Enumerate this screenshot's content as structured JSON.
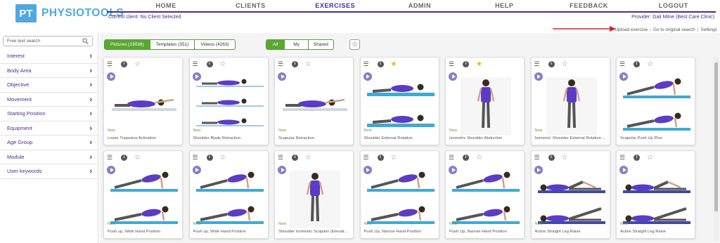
{
  "logo": {
    "mark": "PT",
    "name": "PHYSIOTOOLS"
  },
  "nav": [
    "HOME",
    "CLIENTS",
    "EXERCISES",
    "ADMIN",
    "HELP",
    "FEEDBACK",
    "LOGOUT"
  ],
  "nav_active": "EXERCISES",
  "client_status": "Current client: No Client Selected",
  "provider": "Provider: Gail Milne (Best Care Clinic)",
  "top_links": [
    "+ Upload exercise",
    "Go to original search",
    "Settings"
  ],
  "sidebar": {
    "search_placeholder": "Free text search",
    "filters": [
      "Interest",
      "Body Area",
      "Objective",
      "Movement",
      "Starting Position",
      "Equipment",
      "Age Group",
      "Module",
      "User keywords"
    ]
  },
  "media_tabs": [
    "Pictures (19038)",
    "Templates (351)",
    "Videos (4263)"
  ],
  "scope_tabs": [
    "All",
    "My",
    "Shared"
  ],
  "colors": {
    "brand_purple": "#4a2e8a",
    "logo_blue": "#4fa8e0",
    "green": "#59a832",
    "favorite": "#f5b400"
  },
  "cards": [
    {
      "caption": "Lower Trapezius Activation",
      "new": "New",
      "favorite": false,
      "pose": "prone"
    },
    {
      "caption": "Shoulder Blade Retraction",
      "new": "New",
      "favorite": false,
      "pose": "prone3"
    },
    {
      "caption": "Scapular Retraction",
      "new": "New",
      "favorite": false,
      "pose": "prone"
    },
    {
      "caption": "Shoulder External Rotation",
      "new": "New",
      "favorite": true,
      "pose": "side"
    },
    {
      "caption": "Isometric Shoulder Abduction",
      "new": "New",
      "favorite": true,
      "pose": "stand"
    },
    {
      "caption": "Isometric Shoulder External Rotation ...",
      "new": "New",
      "favorite": false,
      "pose": "stand"
    },
    {
      "caption": "Scapular Push Up Plus",
      "new": "",
      "favorite": false,
      "pose": "plank"
    },
    {
      "caption": "Push up, Wide Hand Position",
      "new": "New",
      "favorite": false,
      "pose": "plank"
    },
    {
      "caption": "Push up, Wide Hand Position",
      "new": "New",
      "favorite": false,
      "pose": "plank"
    },
    {
      "caption": "Shoulder Isometric Scaption (Elevati...",
      "new": "New",
      "favorite": false,
      "pose": "stand"
    },
    {
      "caption": "Push Up, Narrow Hand Position",
      "new": "New",
      "favorite": false,
      "pose": "plank"
    },
    {
      "caption": "Push Up, Narrow Hand Position",
      "new": "New",
      "favorite": false,
      "pose": "plank"
    },
    {
      "caption": "Active Straight Leg Raise",
      "new": "New",
      "favorite": false,
      "pose": "supine"
    },
    {
      "caption": "Active Straight Leg Raise",
      "new": "New",
      "favorite": false,
      "pose": "supine"
    }
  ],
  "icons": {
    "menu": "menu-icon",
    "info": "info-icon",
    "star": "star-icon",
    "play": "play-icon",
    "search": "search-icon",
    "chevron": "chevron-right-icon"
  }
}
